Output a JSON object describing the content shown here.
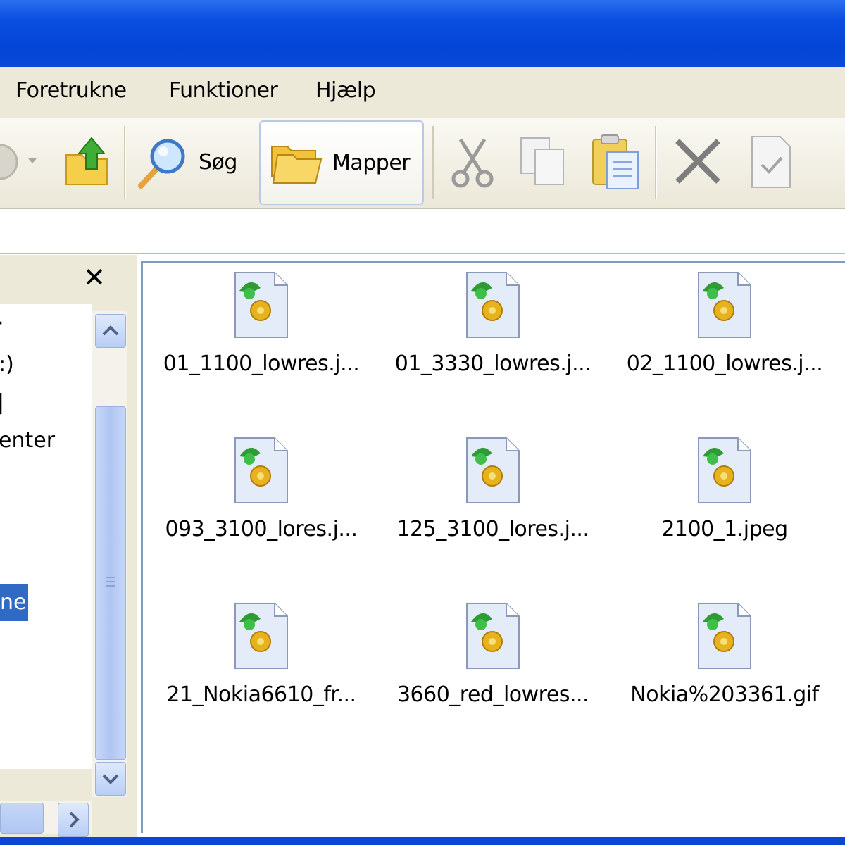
{
  "menu": {
    "items": [
      "Foretrukne",
      "Funktioner",
      "Hjælp"
    ]
  },
  "toolbar": {
    "search_label": "Søg",
    "folders_label": "Mapper"
  },
  "left_pane": {
    "tree_fragments": [
      ":)",
      "enter",
      "ne"
    ]
  },
  "files": [
    {
      "name": "01_1100_lowres.j..."
    },
    {
      "name": "01_3330_lowres.j..."
    },
    {
      "name": "02_1100_lowres.j..."
    },
    {
      "name": "093_3100_lores.j..."
    },
    {
      "name": "125_3100_lores.j..."
    },
    {
      "name": "2100_1.jpeg"
    },
    {
      "name": "21_Nokia6610_fr..."
    },
    {
      "name": "3660_red_lowres..."
    },
    {
      "name": "Nokia%203361.gif"
    }
  ],
  "colors": {
    "titlebar": "#0545d6",
    "chrome": "#ece9d8",
    "selection": "#316ac5"
  }
}
